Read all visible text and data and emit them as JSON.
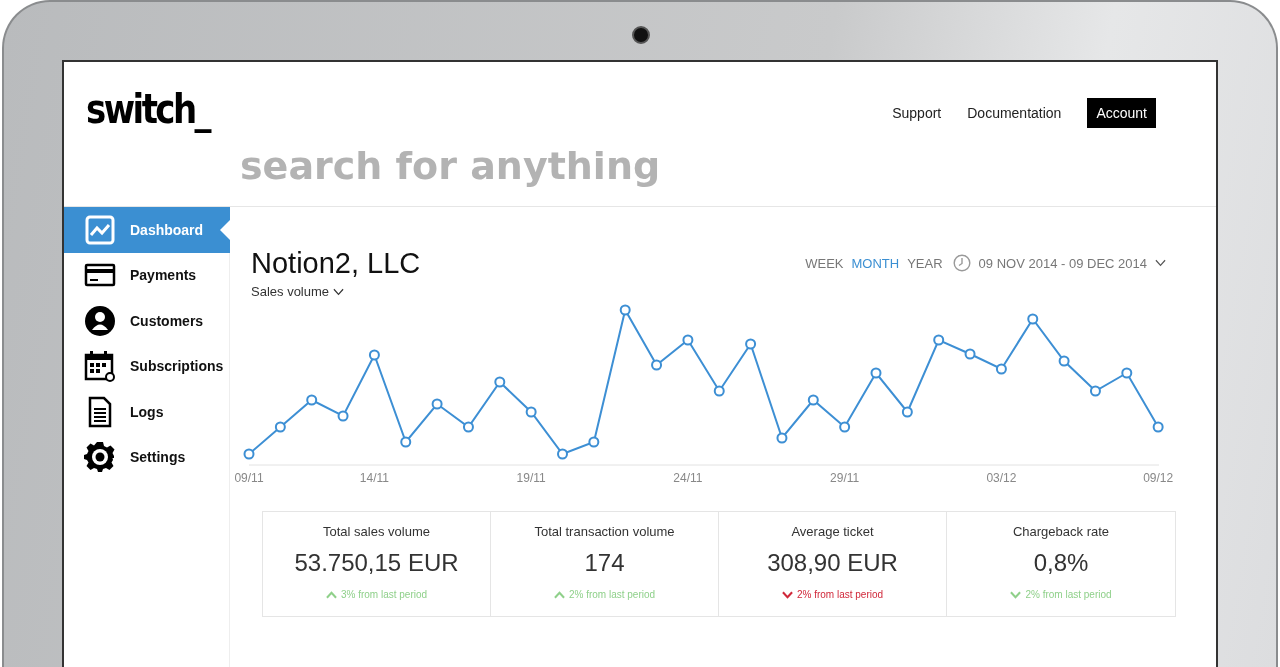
{
  "header": {
    "logo": "switch_",
    "nav": [
      {
        "label": "Support",
        "selected": false
      },
      {
        "label": "Documentation",
        "selected": false
      },
      {
        "label": "Account",
        "selected": true
      }
    ],
    "search": {
      "placeholder": "search for anything"
    }
  },
  "sidebar": {
    "items": [
      {
        "label": "Dashboard",
        "kind": "chart",
        "selected": true
      },
      {
        "label": "Payments",
        "kind": "card",
        "selected": false
      },
      {
        "label": "Customers",
        "kind": "user",
        "selected": false
      },
      {
        "label": "Subscriptions",
        "kind": "calendar",
        "selected": false
      },
      {
        "label": "Logs",
        "kind": "document",
        "selected": false
      },
      {
        "label": "Settings",
        "kind": "gear",
        "selected": false
      }
    ]
  },
  "main": {
    "title": "Notion2, LLC",
    "metric_selector": "Sales volume",
    "periods": [
      {
        "label": "WEEK",
        "selected": false
      },
      {
        "label": "MONTH",
        "selected": true
      },
      {
        "label": "YEAR",
        "selected": false
      }
    ],
    "date_range": "09 NOV 2014 - 09 DEC 2014",
    "chart_x_labels": [
      "09/11",
      "14/11",
      "19/11",
      "24/11",
      "29/11",
      "03/12",
      "09/12"
    ],
    "stats": [
      {
        "label": "Total sales volume",
        "value": "53.750,15 EUR",
        "kind": "up",
        "color": "#8fd08a",
        "change": "3% from last period"
      },
      {
        "label": "Total transaction volume",
        "value": "174",
        "kind": "up",
        "color": "#8fd08a",
        "change": "2% from last period"
      },
      {
        "label": "Average ticket",
        "value": "308,90 EUR",
        "kind": "down",
        "color": "#d0283a",
        "change": "2% from last period"
      },
      {
        "label": "Chargeback rate",
        "value": "0,8%",
        "kind": "down",
        "color": "#8fd08a",
        "change": "2% from last period"
      }
    ]
  }
}
